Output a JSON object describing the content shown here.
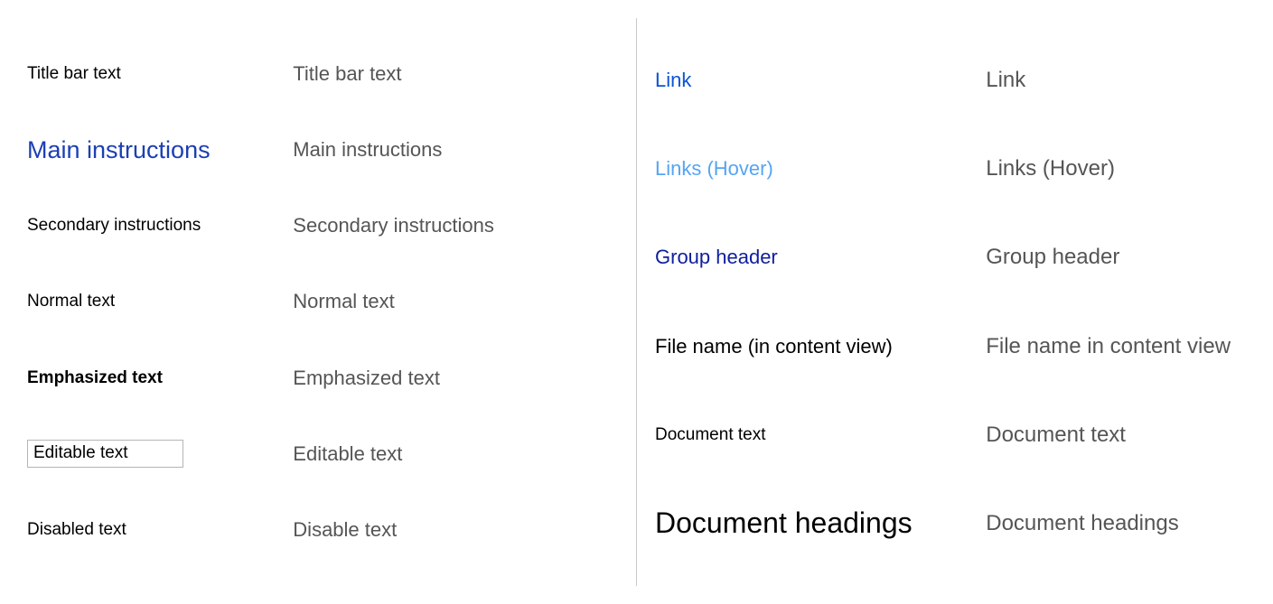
{
  "left": [
    {
      "sample": "Title bar text",
      "desc": "Title bar text",
      "sampleClass": "s-titlebar",
      "name": "title-bar-text",
      "interact": false,
      "descClass": "desc"
    },
    {
      "sample": "Main instructions",
      "desc": "Main instructions",
      "sampleClass": "s-main",
      "name": "main-instructions",
      "interact": false,
      "descClass": "desc"
    },
    {
      "sample": "Secondary instructions",
      "desc": "Secondary instructions",
      "sampleClass": "s-secondary",
      "name": "secondary-instructions",
      "interact": false,
      "descClass": "desc"
    },
    {
      "sample": "Normal text",
      "desc": "Normal text",
      "sampleClass": "s-normal",
      "name": "normal-text",
      "interact": false,
      "descClass": "desc"
    },
    {
      "sample": "Emphasized text",
      "desc": "Emphasized text",
      "sampleClass": "s-emph",
      "name": "emphasized-text",
      "interact": false,
      "descClass": "desc"
    },
    {
      "sample": "Editable text",
      "desc": "Editable text",
      "sampleClass": "s-editable",
      "name": "editable-text",
      "interact": true,
      "descClass": "desc"
    },
    {
      "sample": "Disabled text",
      "desc": "Disable text",
      "sampleClass": "s-disabled",
      "name": "disabled-text",
      "interact": false,
      "descClass": "desc"
    }
  ],
  "right": [
    {
      "sample": "Link",
      "desc": "Link",
      "sampleClass": "s-link",
      "name": "link-text",
      "interact": true,
      "descClass": "desc-lg"
    },
    {
      "sample": "Links (Hover)",
      "desc": "Links (Hover)",
      "sampleClass": "s-linkhover",
      "name": "link-hover-text",
      "interact": true,
      "descClass": "desc-lg"
    },
    {
      "sample": "Group header",
      "desc": "Group header",
      "sampleClass": "s-groupheader",
      "name": "group-header",
      "interact": false,
      "descClass": "desc-lg"
    },
    {
      "sample": "File name (in content view)",
      "desc": "File name in content view",
      "sampleClass": "s-filename",
      "name": "file-name-content-view",
      "interact": false,
      "descClass": "desc-lg"
    },
    {
      "sample": "Document text",
      "desc": "Document text",
      "sampleClass": "s-doctext",
      "name": "document-text",
      "interact": false,
      "descClass": "desc-lg"
    },
    {
      "sample": "Document headings",
      "desc": "Document headings",
      "sampleClass": "s-docheading",
      "name": "document-headings",
      "interact": false,
      "descClass": "desc-lg"
    }
  ]
}
